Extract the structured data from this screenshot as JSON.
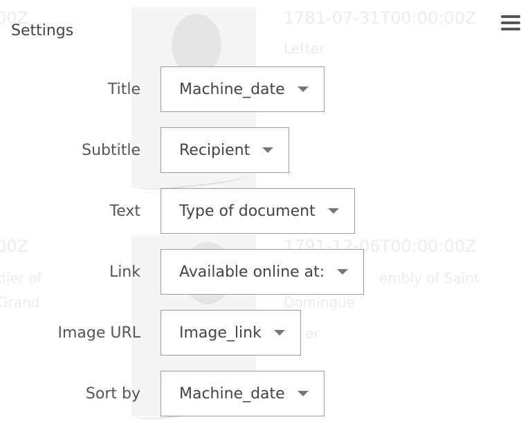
{
  "background": {
    "items": [
      {
        "date": "00Z",
        "type_lines": []
      },
      {
        "date": "1781-07-31T00:00:00Z",
        "type_lines": [
          "Letter"
        ]
      },
      {
        "date": "00Z",
        "type_lines": [
          "dier of",
          "Grand"
        ]
      },
      {
        "date": "1791-12-06T00:00:00Z",
        "type_lines": [
          "embly of Saint",
          "Domingue",
          "er"
        ]
      }
    ]
  },
  "settings": {
    "title": "Settings",
    "menu_icon": "hamburger-menu-icon",
    "rows": [
      {
        "label": "Title",
        "value": "Machine_date"
      },
      {
        "label": "Subtitle",
        "value": "Recipient"
      },
      {
        "label": "Text",
        "value": "Type of document"
      },
      {
        "label": "Link",
        "value": "Available online at:"
      },
      {
        "label": "Image URL",
        "value": "Image_link"
      },
      {
        "label": "Sort by",
        "value": "Machine_date"
      }
    ]
  }
}
